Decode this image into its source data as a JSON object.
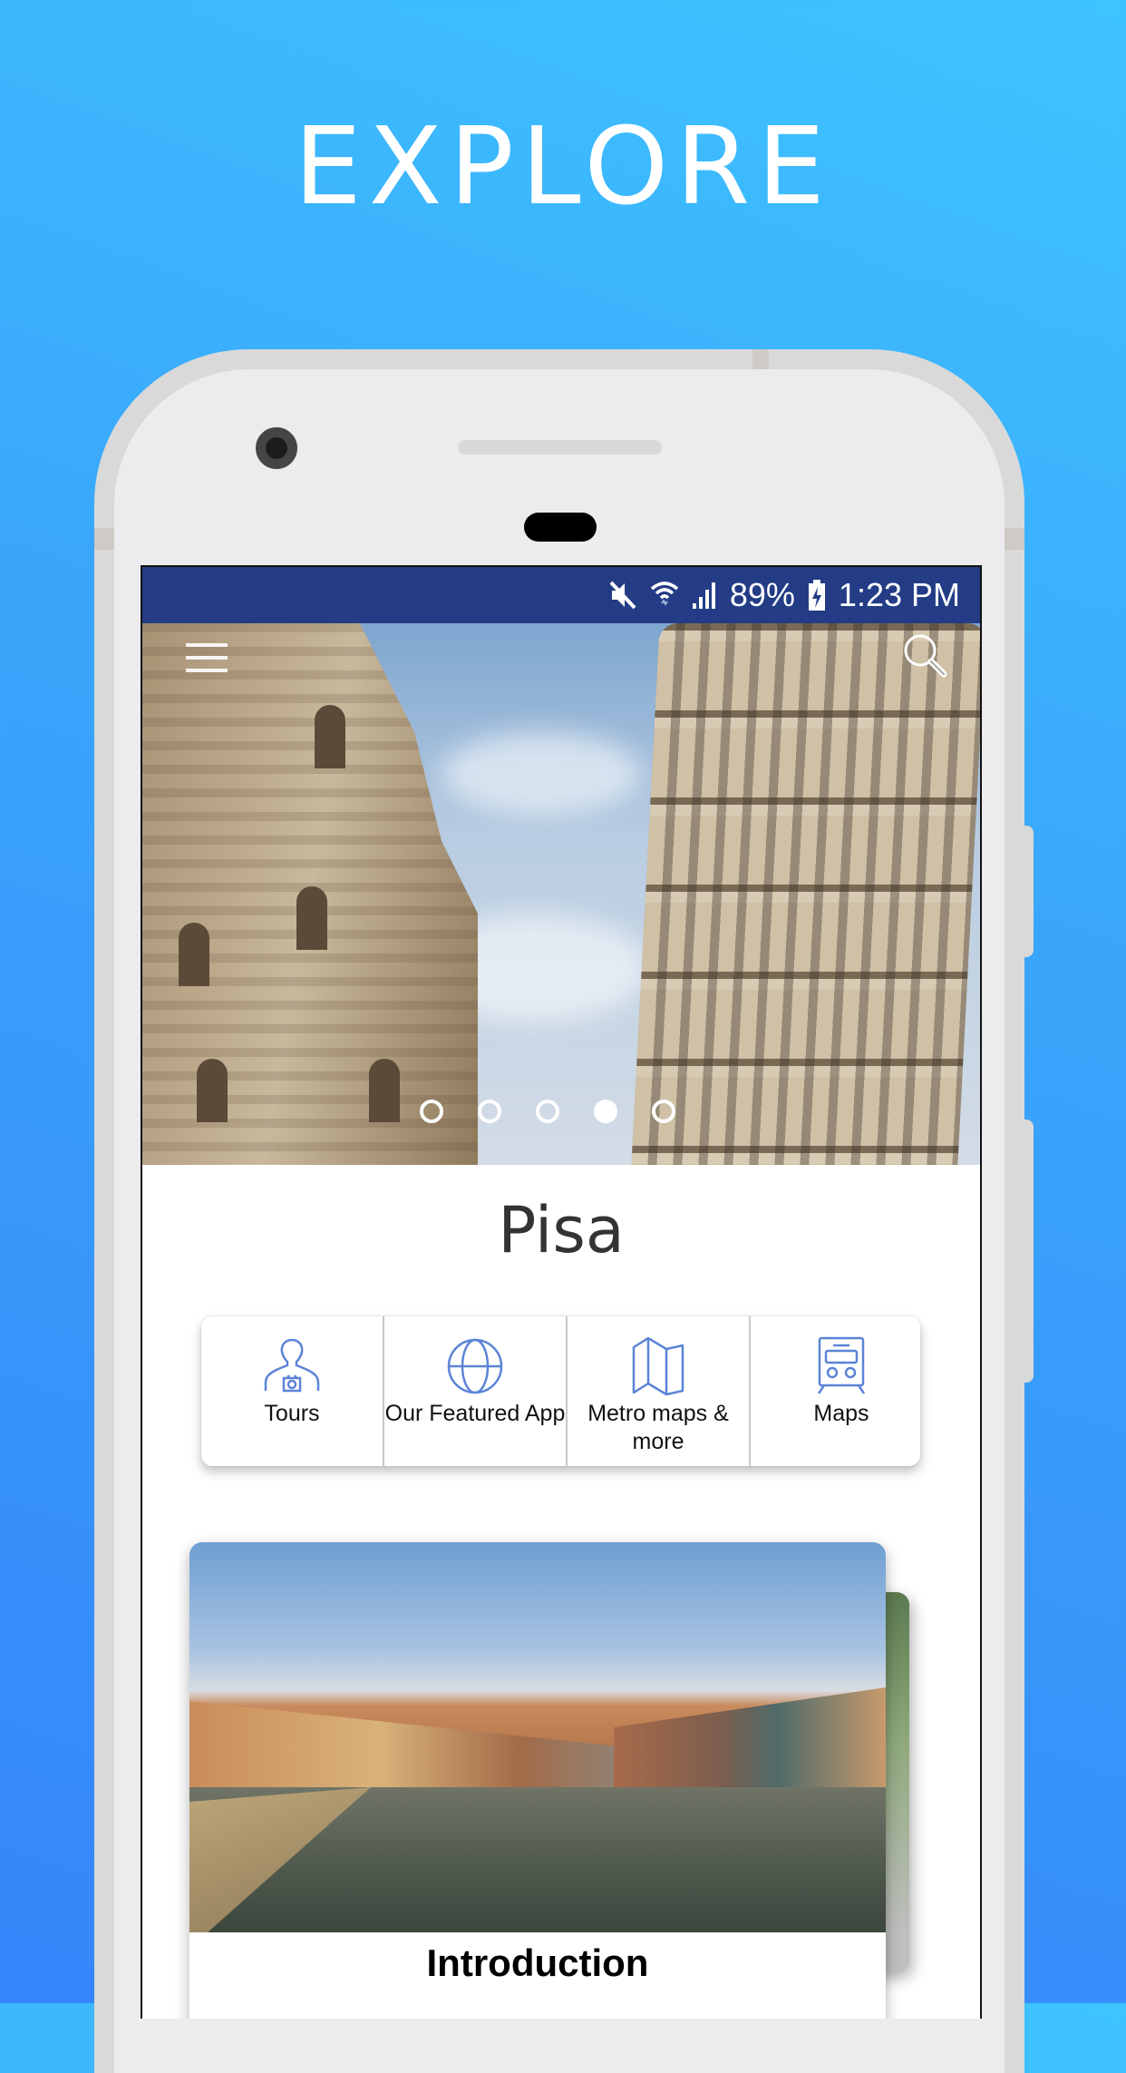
{
  "promo": {
    "headline": "EXPLORE"
  },
  "status_bar": {
    "icons": [
      "mute-icon",
      "wifi-icon",
      "cell-signal-icon",
      "battery-charging-icon"
    ],
    "battery": "89%",
    "time": "1:23 PM",
    "background": "#233c85"
  },
  "hero": {
    "icons": {
      "menu": "hamburger-menu-icon",
      "search": "search-icon"
    },
    "carousel": {
      "total": 5,
      "active_index": 3
    }
  },
  "city": {
    "name": "Pisa"
  },
  "quick_links": [
    {
      "label": "Tours",
      "icon": "tour-guide-icon"
    },
    {
      "label": "Our Featured App",
      "icon": "globe-icon"
    },
    {
      "label": "Metro maps & more",
      "icon": "folded-map-icon"
    },
    {
      "label": "Maps",
      "icon": "train-icon"
    }
  ],
  "accent_color": "#5b84d6",
  "cards": [
    {
      "title": "Introduction"
    }
  ]
}
